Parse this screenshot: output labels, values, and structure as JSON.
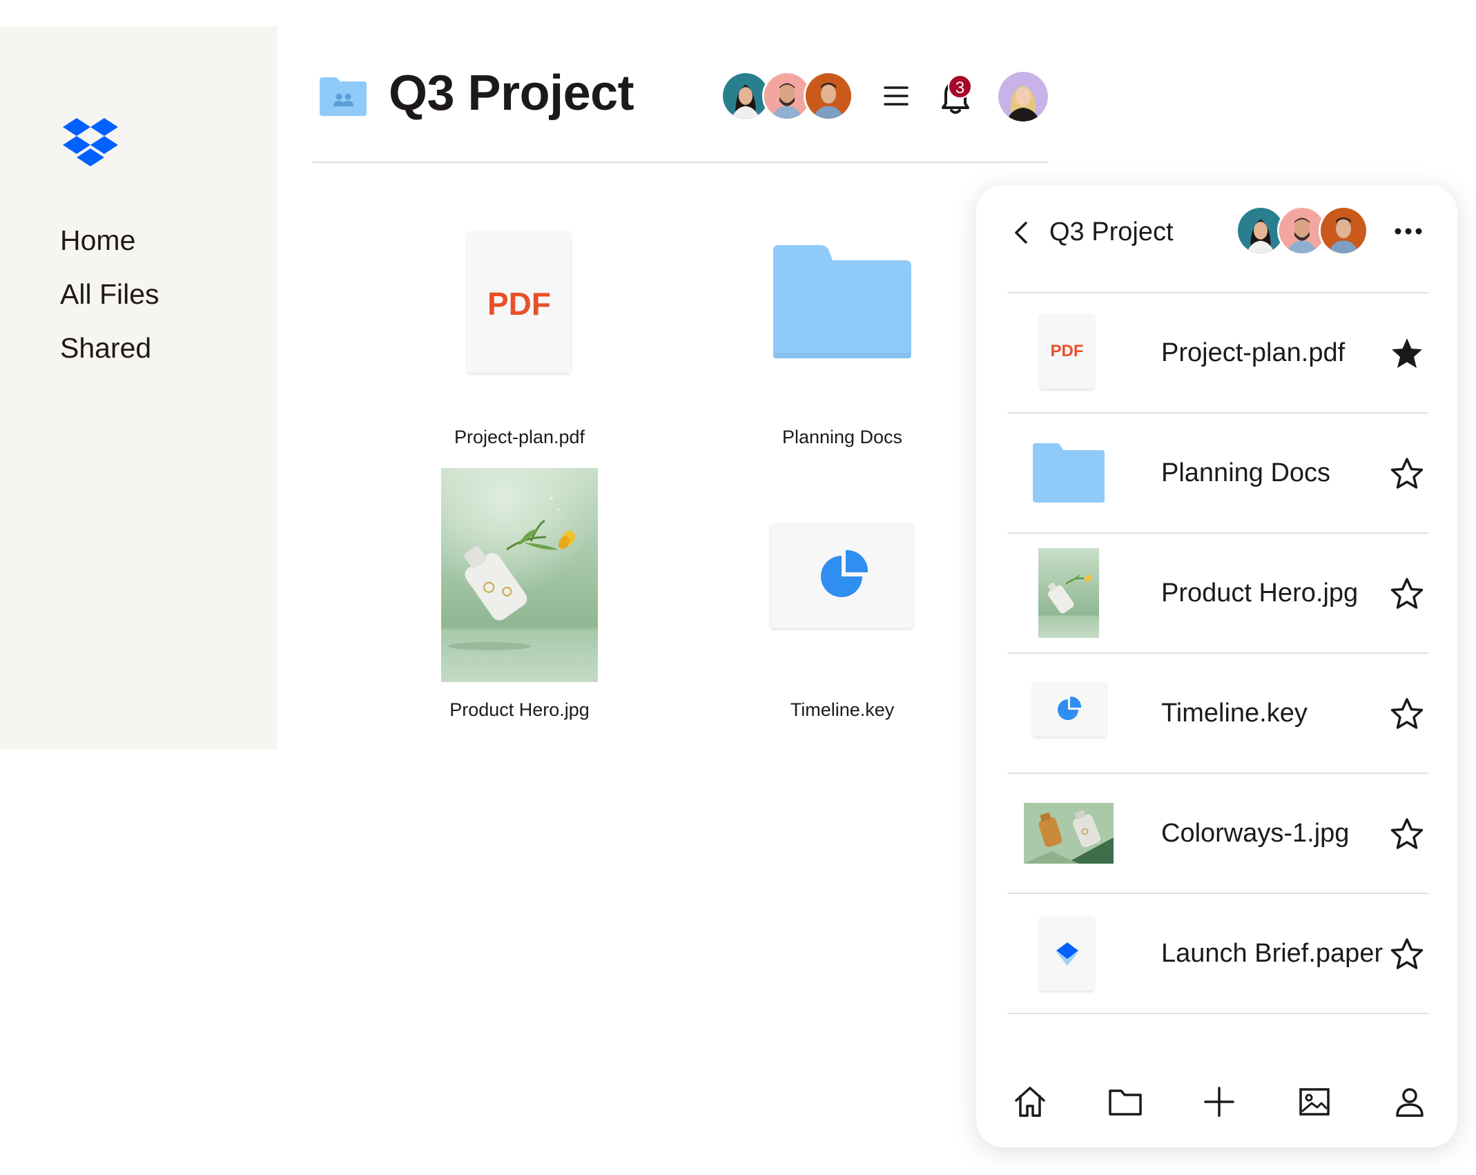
{
  "sidebar": {
    "logo": "dropbox-logo",
    "items": [
      {
        "label": "Home"
      },
      {
        "label": "All Files"
      },
      {
        "label": "Shared"
      }
    ]
  },
  "header": {
    "folder_icon": "shared-folder-icon",
    "title": "Q3 Project",
    "menu_icon": "hamburger-menu-icon",
    "notifications": {
      "icon": "bell-icon",
      "count": "3"
    },
    "collaborator_avatars": 3
  },
  "grid": {
    "files": [
      {
        "name": "Project-plan.pdf",
        "thumb_text": "PDF",
        "type": "pdf"
      },
      {
        "name": "Planning Docs",
        "type": "folder"
      },
      {
        "name": "Product Hero.jpg",
        "type": "image"
      },
      {
        "name": "Timeline.key",
        "type": "keynote"
      }
    ]
  },
  "mobile": {
    "title": "Q3 Project",
    "back_icon": "chevron-left-icon",
    "more_icon": "more-dots-icon",
    "files": [
      {
        "name": "Project-plan.pdf",
        "thumb_text": "PDF",
        "type": "pdf",
        "starred": true
      },
      {
        "name": "Planning Docs",
        "type": "folder",
        "starred": false
      },
      {
        "name": "Product Hero.jpg",
        "type": "image",
        "starred": false
      },
      {
        "name": "Timeline.key",
        "type": "keynote",
        "starred": false
      },
      {
        "name": "Colorways-1.jpg",
        "type": "image",
        "starred": false
      },
      {
        "name": "Launch Brief.paper",
        "type": "paper",
        "starred": false
      }
    ],
    "tabbar": [
      "home-icon",
      "folder-icon",
      "plus-icon",
      "photos-icon",
      "account-icon"
    ]
  },
  "colors": {
    "dropbox_blue": "#0061fe",
    "folder_blue": "#90caf9",
    "pdf_orange": "#e8502a",
    "badge_red": "#a6052c",
    "sidebar_bg": "#f7f5f2",
    "photo_green": "#9fc4a2"
  }
}
